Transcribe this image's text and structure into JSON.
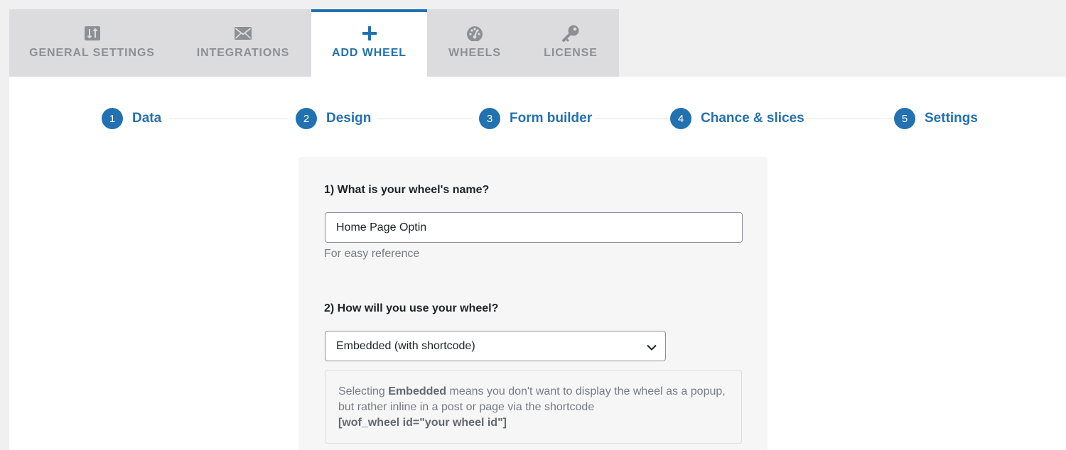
{
  "tabs": [
    {
      "label": "General Settings",
      "icon": "sliders-icon",
      "active": false
    },
    {
      "label": "Integrations",
      "icon": "envelope-icon",
      "active": false
    },
    {
      "label": "Add Wheel",
      "icon": "plus-icon",
      "active": true
    },
    {
      "label": "Wheels",
      "icon": "dashboard-icon",
      "active": false
    },
    {
      "label": "License",
      "icon": "key-icon",
      "active": false
    }
  ],
  "steps": [
    {
      "num": "1",
      "label": "Data"
    },
    {
      "num": "2",
      "label": "Design"
    },
    {
      "num": "3",
      "label": "Form builder"
    },
    {
      "num": "4",
      "label": "Chance & slices"
    },
    {
      "num": "5",
      "label": "Settings"
    }
  ],
  "form": {
    "name_question": "1) What is your wheel's name?",
    "name_value": "Home Page Optin",
    "name_hint": "For easy reference",
    "usage_question": "2) How will you use your wheel?",
    "usage_selected": "Embedded (with shortcode)",
    "info": {
      "prefix": "Selecting ",
      "bold": "Embedded",
      "middle": " means you don't want to display the wheel as a popup, but rather inline in a post or page via the shortcode",
      "shortcode": "[wof_wheel id=\"your wheel id\"]"
    }
  },
  "colors": {
    "accent": "#2271b1",
    "tab_bg": "#dcdcde",
    "inactive_text": "#8c8f94",
    "page_bg": "#f0f0f1"
  }
}
